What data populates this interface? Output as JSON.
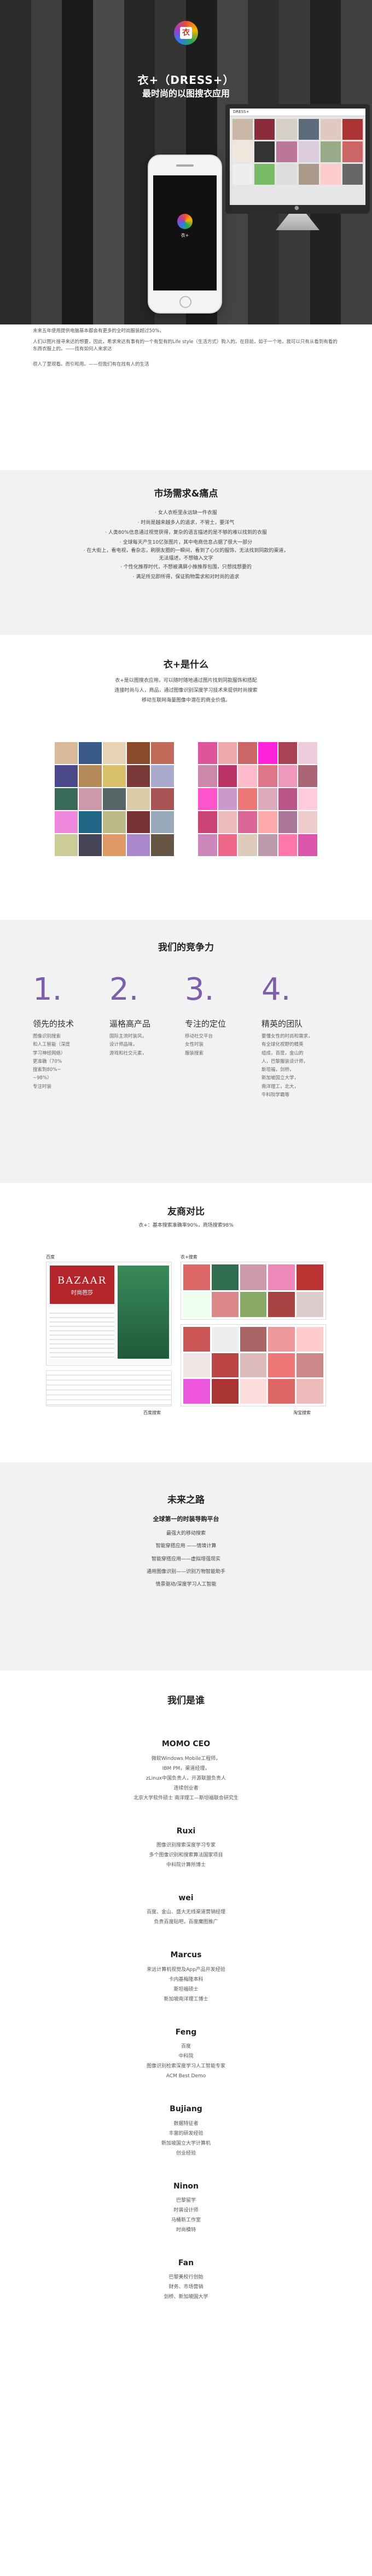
{
  "hero": {
    "logo_icon": "dress-icon",
    "title": "衣+（DRESS+）",
    "subtitle": "最时尚的以图搜衣应用",
    "phone_app_name": "衣+",
    "monitor_brand": "DRESS+"
  },
  "intro": {
    "p1": "未来五年使用提供电脑基本都会有更多的全时尚服装超过50%，",
    "p2": "人们以图片搜寻来达的想要，因此，希求来达有事有的一个有型有的Life style（生活方式）购入的。在目前，如于一个地，我可以只有从看到有看的东西衣服上的。——找有如何人来求达",
    "p3": "很人了里观看。而引和用。——但我们有在找有人的生活"
  },
  "market": {
    "title": "市场需求&痛点",
    "items": [
      "· 女人衣柜里永远缺一件衣服",
      "· 时尚是越来越多人的追求，不管土，要洋气",
      "· 人类80%信息通过视觉获得，复杂的语言描述的是不够的难以找到的衣服",
      "· 全球每天产生10亿张图片，其中电商信息占据了很大一部分",
      "· 在大街上，看电视，看杂志，刷朋友圈的一瞬间，看到了心仪的服饰，无法找到同款的渠道，无法描述，不想输入文字",
      "· 个性化推荐时代，不想被满屏小推推荐包围，只想找想要的",
      "· 满足所见即所得，保证购物需求和对时尚的追求"
    ]
  },
  "whatis": {
    "title": "衣+是什么",
    "lines": [
      "衣+是以图搜衣应用，可以随时随地通过图片找到同款服饰和搭配",
      "连接时尚与人，商品，通过图像识别深度学习技术来提供时尚搜索",
      "移动互联网海量图像中潜在的商业价值。"
    ]
  },
  "compete": {
    "title": "我们的竞争力",
    "cols": [
      {
        "num": "1.",
        "head": "领先的技术",
        "text": [
          "图像识别搜索",
          "和人工智能（深度",
          "学习神经网络）",
          "更准确（70%",
          "搜索到80%~",
          "~98%）",
          "专注时装"
        ]
      },
      {
        "num": "2.",
        "head": "逼格高产品",
        "text": [
          "国际主流时装风，",
          "设计师品味，",
          "游戏和社交元素，"
        ]
      },
      {
        "num": "3.",
        "head": "专注的定位",
        "text": [
          "移动社交平台",
          "女性时装",
          "服装搜索"
        ]
      },
      {
        "num": "4.",
        "head": "精英的团队",
        "text": [
          "要懂女性的时尚和需求，",
          "有全球化视野的精英",
          "组成，百度，金山的",
          "人，巴黎服装设计师，",
          "斯坦福，剑桥，",
          "新加坡国立大学，",
          "南洋理工，北大，",
          "牛科院学霸等"
        ]
      }
    ]
  },
  "compare": {
    "title": "友商对比",
    "subtitle": "衣+：基本搜索准确率90%，商场搜索98%",
    "left_label": "百度",
    "right_label": "衣+搜索",
    "left_ad_text": "BAZAAR",
    "left_ad_sub": "时尚芭莎",
    "bottom_left_caption": "百度搜索",
    "bottom_right_caption": "淘宝搜索"
  },
  "future": {
    "title": "未来之路",
    "lead": "全球第一的时装导购平台",
    "items": [
      "最强大的移动搜索",
      "智能穿搭应用 ——情境计算",
      "智能穿搭应用——虚拟增强现实",
      "通用图像识别——识别万物智能助手",
      "情景驱动/深度学习人工智能"
    ]
  },
  "team": {
    "title": "我们是谁",
    "members": [
      {
        "name": "MOMO   CEO",
        "desc": [
          "微软Windows Mobile工程师，",
          "IBM PM，渠道经理，",
          "zLinux中国负责人，开源联盟负责人",
          "连续创业者",
          "北京大学软件硕士 南洋理工—斯坦福联合研究生"
        ]
      },
      {
        "name": "Ruxi",
        "desc": [
          "图像识别搜索深度学习专家",
          "多个图像识别和搜索算法国家项目",
          "中科院计算所博士"
        ]
      },
      {
        "name": "wei",
        "desc": [
          "百度、金山、盛大无线渠道营销经理",
          "负责百度贴吧，百度魔图推广"
        ]
      },
      {
        "name": "Marcus",
        "desc": [
          "来远计算机视觉及App产品开发经验",
          "卡内基梅隆本科",
          "斯坦福硕士",
          "新加坡南洋理工博士"
        ]
      },
      {
        "name": "Feng",
        "desc": [
          "百度",
          "中科院",
          "图像识别检索深度学习人工智能专家",
          "ACM Best Demo"
        ]
      },
      {
        "name": "Bujiang",
        "desc": [
          "数据特征者",
          "丰富的研发经验",
          "新加坡国立大学计算机",
          "创业经验"
        ]
      },
      {
        "name": "Ninon",
        "desc": [
          "巴黎留学",
          "时装设计师",
          "马桶新工作室",
          "时尚模特"
        ]
      },
      {
        "name": "Fan",
        "desc": [
          "巴黎美校行创始",
          "财务、市场营销",
          "剑桥、新加坡国大学"
        ]
      }
    ]
  },
  "colors": {
    "accent": "#7e5ea8",
    "hero_bg": "#1f1f1f",
    "section_gray": "#f2f2f2"
  }
}
